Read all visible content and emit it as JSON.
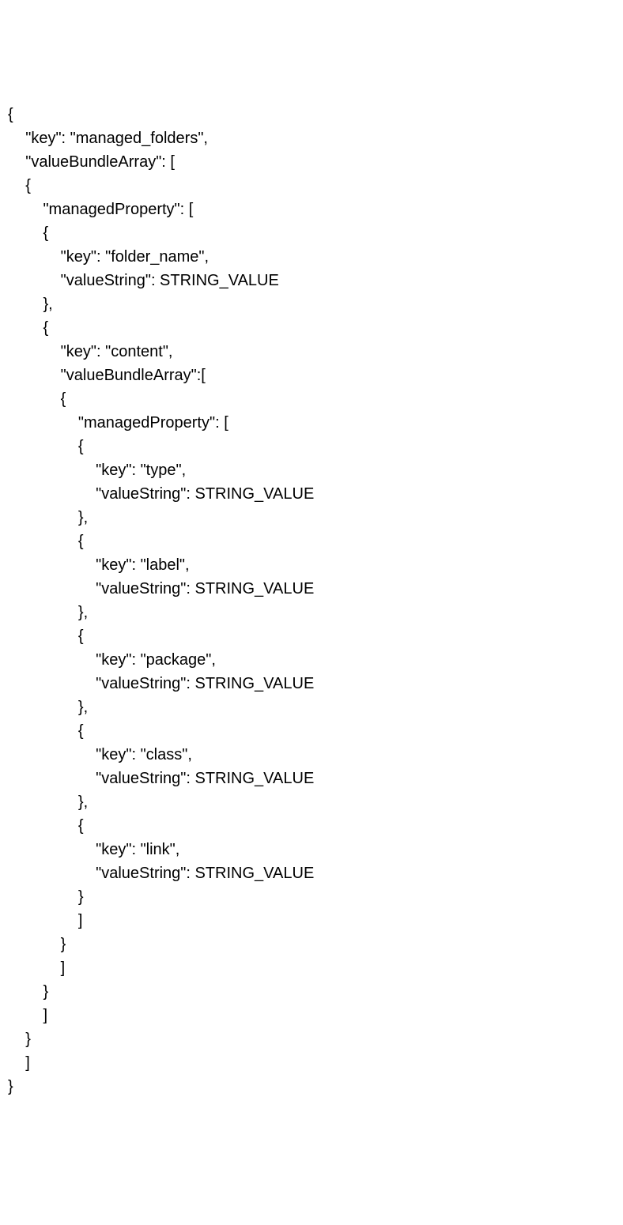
{
  "code": {
    "lines": [
      "{",
      "    \"key\": \"managed_folders\",",
      "    \"valueBundleArray\": [",
      "    {",
      "        \"managedProperty\": [",
      "        {",
      "            \"key\": \"folder_name\",",
      "            \"valueString\": STRING_VALUE",
      "        },",
      "        {",
      "            \"key\": \"content\",",
      "            \"valueBundleArray\":[",
      "            {",
      "                \"managedProperty\": [",
      "                {",
      "                    \"key\": \"type\",",
      "                    \"valueString\": STRING_VALUE",
      "                },",
      "                {",
      "                    \"key\": \"label\",",
      "                    \"valueString\": STRING_VALUE",
      "                },",
      "                {",
      "                    \"key\": \"package\",",
      "                    \"valueString\": STRING_VALUE",
      "                },",
      "                {",
      "                    \"key\": \"class\",",
      "                    \"valueString\": STRING_VALUE",
      "                },",
      "                {",
      "                    \"key\": \"link\",",
      "                    \"valueString\": STRING_VALUE",
      "                }",
      "                ]",
      "            }",
      "            ]",
      "        }",
      "        ]",
      "    }",
      "    ]",
      "}"
    ]
  }
}
